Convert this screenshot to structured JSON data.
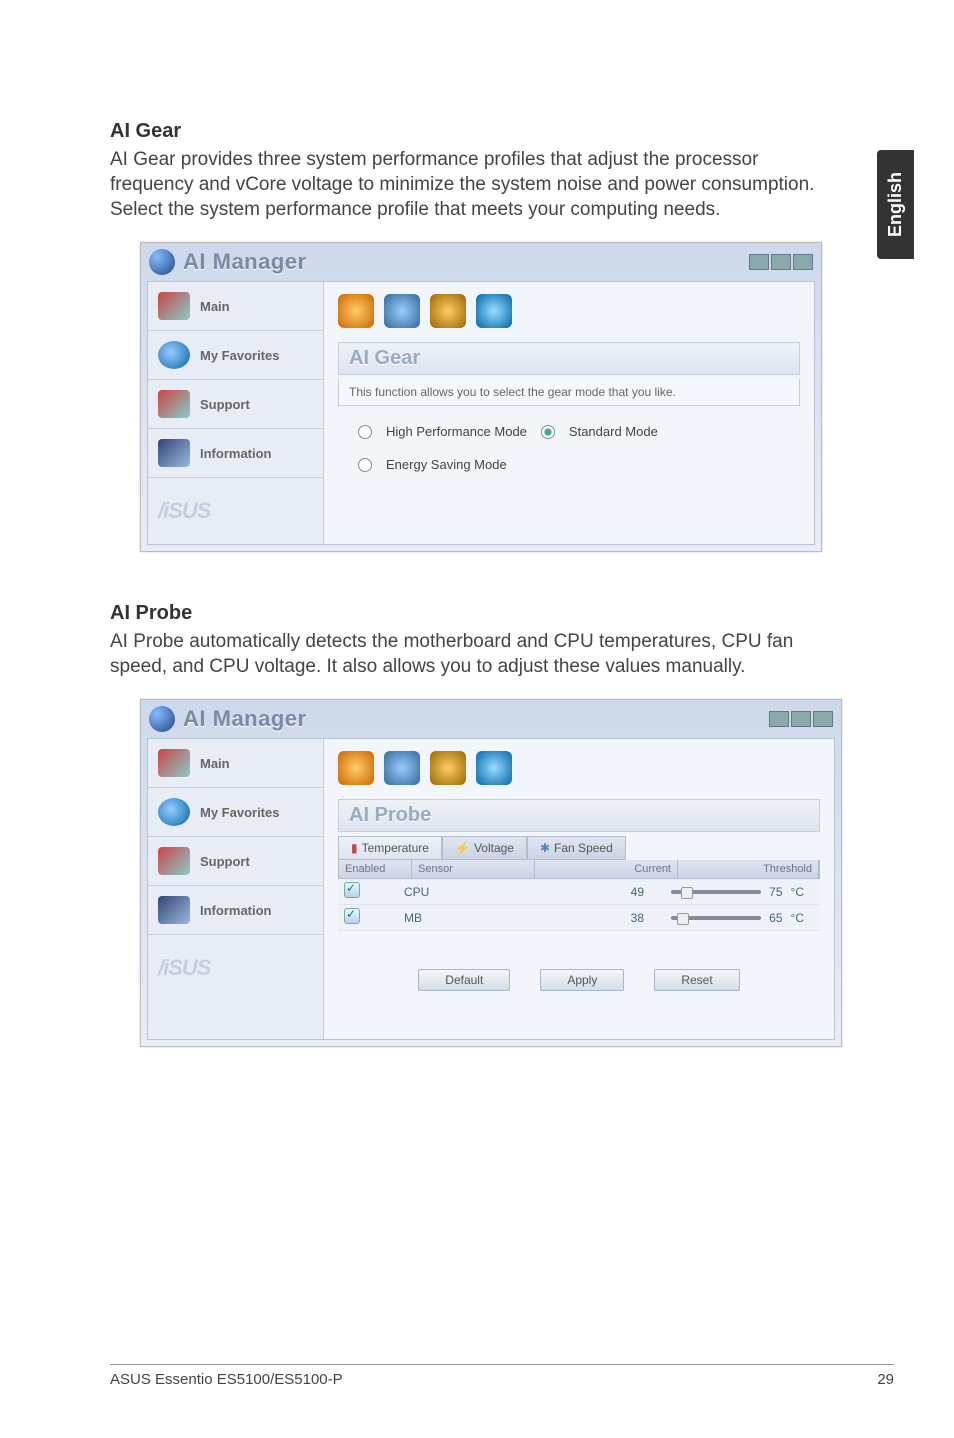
{
  "page_tab": "English",
  "section1": {
    "title": "AI Gear",
    "body": "AI Gear provides three system performance profiles that adjust the processor frequency and vCore voltage to minimize the system noise and power consumption. Select the system performance profile that meets your computing needs."
  },
  "section2": {
    "title": "AI Probe",
    "body": "AI Probe automatically detects the motherboard and CPU temperatures, CPU fan speed, and CPU voltage. It also allows you to adjust these values manually."
  },
  "app": {
    "title": "AI Manager",
    "sidebar": {
      "main": "Main",
      "favorites": "My Favorites",
      "support": "Support",
      "information": "Information",
      "brand": "/iSUS"
    }
  },
  "gear": {
    "pane_title": "AI Gear",
    "desc": "This function allows you to select the gear mode that you like.",
    "opt_high": "High Performance Mode",
    "opt_std": "Standard Mode",
    "opt_energy": "Energy Saving Mode"
  },
  "probe": {
    "pane_title": "AI Probe",
    "tabs": {
      "temp": "Temperature",
      "volt": "Voltage",
      "fan": "Fan Speed"
    },
    "headers": {
      "enabled": "Enabled",
      "sensor": "Sensor",
      "current": "Current",
      "threshold": "Threshold"
    },
    "rows": [
      {
        "sensor": "CPU",
        "current": "49",
        "threshold": "75",
        "unit": "°C",
        "knob": 60
      },
      {
        "sensor": "MB",
        "current": "38",
        "threshold": "65",
        "unit": "°C",
        "knob": 70
      }
    ],
    "buttons": {
      "default": "Default",
      "apply": "Apply",
      "reset": "Reset"
    }
  },
  "footer": {
    "left": "ASUS Essentio ES5100/ES5100-P",
    "right": "29"
  }
}
